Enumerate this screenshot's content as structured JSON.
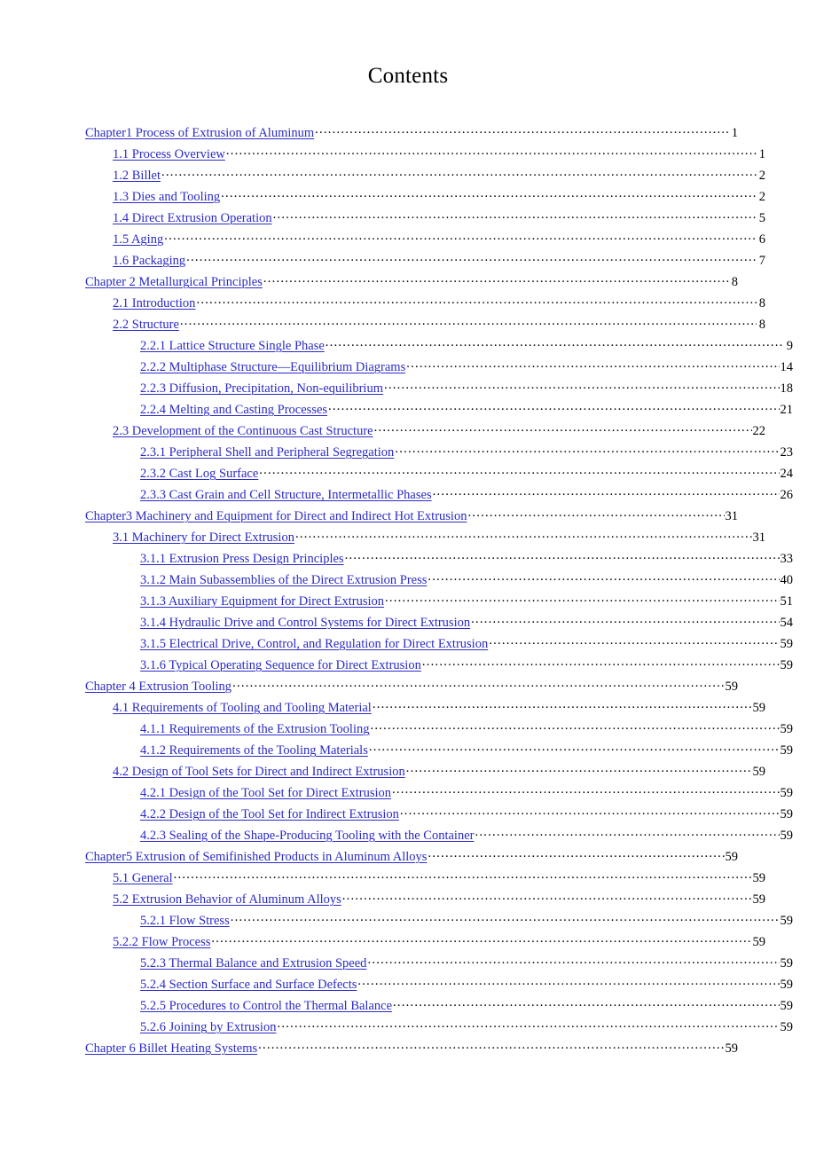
{
  "document": {
    "title": "Contents",
    "link_color": "#2a2ac8",
    "text_color": "#000000",
    "background_color": "#ffffff"
  },
  "toc": {
    "entries": [
      {
        "label": "Chapter1 Process of Extrusion of Aluminum",
        "page": "1",
        "level": 1
      },
      {
        "label": "1.1 Process Overview",
        "page": "1",
        "level": 2
      },
      {
        "label": "1.2    Billet",
        "page": "2",
        "level": 2
      },
      {
        "label": "1.3 Dies and Tooling",
        "page": "2",
        "level": 2
      },
      {
        "label": "1.4 Direct Extrusion Operation",
        "page": "5",
        "level": 2
      },
      {
        "label": "1.5 Aging",
        "page": "6",
        "level": 2
      },
      {
        "label": "1.6 Packaging",
        "page": "7",
        "level": 2
      },
      {
        "label": "Chapter 2 Metallurgical Principles",
        "page": "8",
        "level": 1
      },
      {
        "label": "2.1 Introduction",
        "page": "8",
        "level": 2
      },
      {
        "label": "2.2 Structure",
        "page": "8",
        "level": 2
      },
      {
        "label": "2.2.1 Lattice Structure Single Phase",
        "page": "9",
        "level": 3
      },
      {
        "label": "2.2.2 Multiphase Structure—Equilibrium Diagrams",
        "page": "14",
        "level": 3
      },
      {
        "label": "2.2.3 Diffusion, Precipitation, Non-equilibrium",
        "page": "18",
        "level": 3
      },
      {
        "label": "2.2.4 Melting and Casting Processes",
        "page": "21",
        "level": 3
      },
      {
        "label": "2.3 Development of the Continuous Cast Structure",
        "page": "22",
        "level": 2
      },
      {
        "label": "2.3.1 Peripheral Shell and Peripheral Segregation",
        "page": "23",
        "level": 3
      },
      {
        "label": "2.3.2 Cast Log Surface",
        "page": "24",
        "level": 3
      },
      {
        "label": "2.3.3 Cast Grain and Cell Structure, Intermetallic Phases",
        "page": "26",
        "level": 3
      },
      {
        "label": "Chapter3 Machinery and Equipment for Direct and Indirect Hot Extrusion",
        "page": "31",
        "level": 1
      },
      {
        "label": "3.1 Machinery for Direct Extrusion",
        "page": "31",
        "level": 2
      },
      {
        "label": "3.1.1 Extrusion Press Design Principles",
        "page": "33",
        "level": 3
      },
      {
        "label": "3.1.2 Main Subassemblies of the Direct Extrusion Press",
        "page": "40",
        "level": 3
      },
      {
        "label": "3.1.3 Auxiliary Equipment for Direct Extrusion",
        "page": "51",
        "level": 3
      },
      {
        "label": "3.1.4 Hydraulic Drive and Control Systems for Direct Extrusion",
        "page": "54",
        "level": 3
      },
      {
        "label": "3.1.5 Electrical Drive, Control, and Regulation for Direct Extrusion",
        "page": "59",
        "level": 3
      },
      {
        "label": "3.1.6 Typical Operating Sequence for Direct Extrusion",
        "page": "59",
        "level": 3
      },
      {
        "label": "Chapter 4    Extrusion Tooling",
        "page": "59",
        "level": 1
      },
      {
        "label": "4.1 Requirements of Tooling and Tooling Material",
        "page": "59",
        "level": 2
      },
      {
        "label": "4.1.1 Requirements of the Extrusion Tooling",
        "page": "59",
        "level": 3
      },
      {
        "label": "4.1.2 Requirements of the Tooling Materials",
        "page": "59",
        "level": 3
      },
      {
        "label": "4.2 Design of Tool Sets for Direct and Indirect Extrusion",
        "page": "59",
        "level": 2
      },
      {
        "label": "4.2.1 Design of the Tool Set for Direct Extrusion",
        "page": "59",
        "level": 3
      },
      {
        "label": "4.2.2 Design of the Tool Set for Indirect Extrusion",
        "page": "59",
        "level": 3
      },
      {
        "label": "4.2.3 Sealing of the Shape-Producing Tooling with the Container",
        "page": "59",
        "level": 3
      },
      {
        "label": "Chapter5 Extrusion of Semifinished Products in Aluminum Alloys",
        "page": "59",
        "level": 1
      },
      {
        "label": "5.1 General",
        "page": "59",
        "level": 2
      },
      {
        "label": "5.2 Extrusion Behavior of Aluminum Alloys",
        "page": "59",
        "level": 2
      },
      {
        "label": "5.2.1 Flow Stress",
        "page": "59",
        "level": 3
      },
      {
        "label": "5.2.2 Flow Process",
        "page": "59",
        "level": 2
      },
      {
        "label": "5.2.3 Thermal Balance and Extrusion Speed",
        "page": "59",
        "level": 3
      },
      {
        "label": "5.2.4 Section Surface and Surface Defects",
        "page": "59",
        "level": 3
      },
      {
        "label": "5.2.5 Procedures to Control the Thermal Balance",
        "page": "59",
        "level": 3
      },
      {
        "label": "5.2.6 Joining by Extrusion",
        "page": "59",
        "level": 3
      },
      {
        "label": "Chapter 6 Billet Heating Systems",
        "page": "59",
        "level": 1
      }
    ]
  }
}
